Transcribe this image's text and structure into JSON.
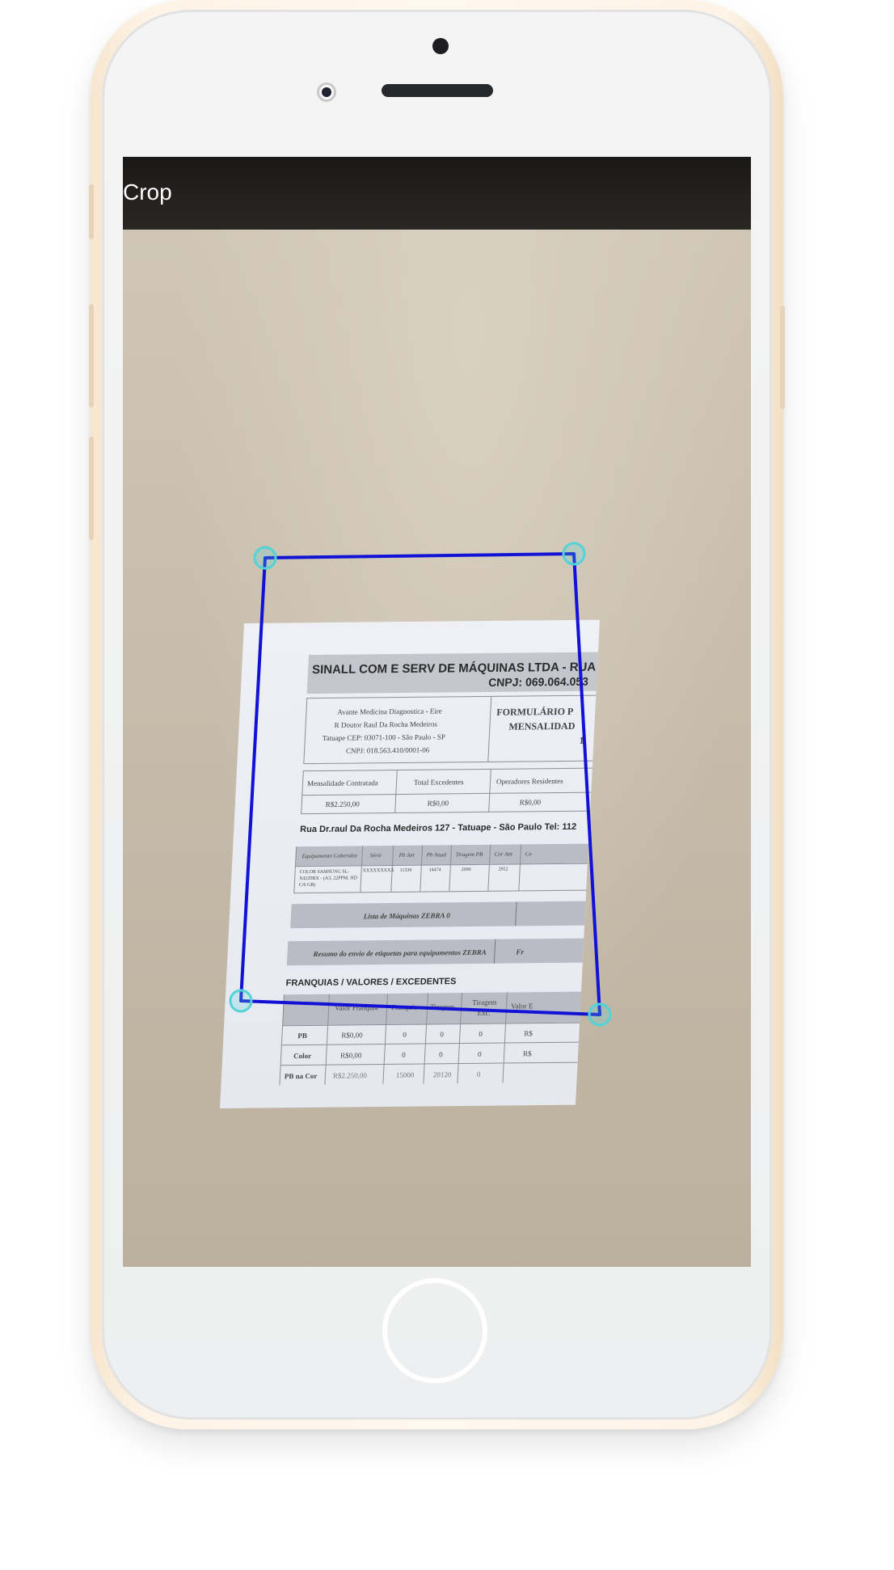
{
  "app_bar": {
    "title": "Crop"
  },
  "document": {
    "heading_1": "SINALL COM E SERV DE MÁQUINAS LTDA - RUA",
    "heading_2": "CNPJ: 069.064.053",
    "address": [
      "Avante Medicina Diagnostica - Eire",
      "R Doutor Raul Da Rocha Medeiros",
      "Tatuape CEP: 03071-100 - São Paulo - SP",
      "CNPJ: 018.563.410/0001-06"
    ],
    "form_title_1": "FORMULÁRIO P",
    "form_title_2": "MENSALIDAD",
    "form_title_3": "1",
    "summary_headers": [
      "Mensalidade Contratada",
      "Total Excedentes",
      "Operadores Residentes"
    ],
    "summary_values": [
      "R$2.250,00",
      "R$0,00",
      "R$0,00"
    ],
    "street_line": "Rua Dr.raul Da Rocha Medeiros  127 - Tatuape - São Paulo Tel: 112",
    "equip_headers": [
      "Equipamento Coberidos",
      "Série",
      "Pb Ant",
      "Pb Atual",
      "Tiragem PB",
      "Cor Ant",
      "Co"
    ],
    "equip_row": [
      "COLOR SAMSUNG SL-X4220RX - (A3, 22PPM, HD C/6 GB)",
      "XXXXXXXXX",
      "11336",
      "14474",
      "2090",
      "2952",
      ""
    ],
    "zebra_list": "Lista de Máquinas ZEBRA  0",
    "zebra_summary": "Resumo do envio de etiquetas para equipamentos ZEBRA",
    "zebra_summary_right": "Fr",
    "franchise_title": "FRANQUIAS / VALORES / EXCEDENTES",
    "franchise_headers": [
      "",
      "Valor Franquia",
      "Franquia",
      "Tiragem",
      "Tiragem Exc.",
      "Valor E"
    ],
    "franchise_rows": [
      [
        "PB",
        "R$0,00",
        "0",
        "0",
        "0",
        "R$"
      ],
      [
        "Color",
        "R$0,00",
        "0",
        "0",
        "0",
        "R$"
      ],
      [
        "PB na Cor",
        "R$2.250,00",
        "15000",
        "20120",
        "0",
        ""
      ]
    ]
  },
  "colors": {
    "crop_line": "#1212d6",
    "handle": "#52d3d8",
    "app_bar": "#1b1918"
  }
}
